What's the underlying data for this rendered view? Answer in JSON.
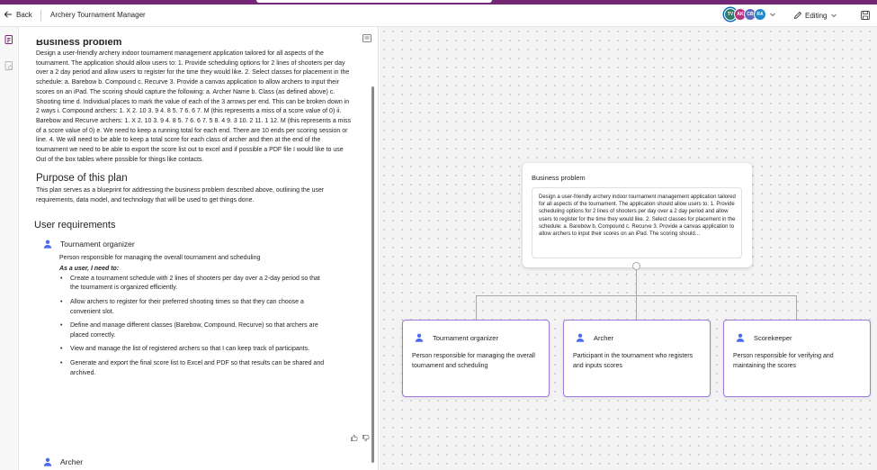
{
  "header": {
    "back_label": "Back",
    "app_title": "Archery Tournament Manager",
    "editing_label": "Editing",
    "avatars": [
      {
        "initials": "TV",
        "color": "#2e7d6b"
      },
      {
        "initials": "AK",
        "color": "#b4367f"
      },
      {
        "initials": "CB",
        "color": "#5c6bc0"
      },
      {
        "initials": "RA",
        "color": "#1e88c9"
      }
    ]
  },
  "document": {
    "business_heading": "Business problem",
    "business_text": "Design a user-friendly archery indoor tournament management application tailored for all aspects of the tournament. The application should allow users to: 1. Provide scheduling options for 2 lines of shooters per day over a 2 day period and allow users to register for the time they would like. 2. Select classes for placement in the schedule: a. Barebow b. Compound c. Recurve 3. Provide a canvas application to allow archers to input their scores on an iPad. The scoring should capture the following: a. Archer Name b. Class (as defined above) c. Shooting time d. Individual places to mark the value of each of the 3 arrows per end. This can be broken down in 2 ways i. Compound archers: 1. X 2. 10 3. 9 4. 8 5. 7 6. 6 7. M (this represents a miss of a score value of 0) ii. Barebow and Recurve archers: 1. X 2. 10 3. 9 4. 8 5. 7 6. 6 7. 5 8. 4 9. 3 10. 2 11. 1 12. M (this represents a miss of a score value of 0) e. We need to keep a running total for each end. There are 10 ends per scoring session or line. 4. We will need to be able to keep a total score for each class of archer and then at the end of the tournament we need to be able to export the score list out to excel and if possible a PDF file I would like to use Out of the box tables where possible for things like contacts.",
    "purpose_heading": "Purpose of this plan",
    "purpose_text": "This plan serves as a blueprint for addressing the business problem described above, outlining the user requirements, data model, and technology that will be used to get things done.",
    "requirements_heading": "User requirements",
    "personas": [
      {
        "name": "Tournament organizer",
        "description": "Person responsible for managing the overall tournament and scheduling",
        "need_label": "As a user, I need to:",
        "needs": [
          "Create a tournament schedule with 2 lines of shooters per day over a 2-day period so that the tournament is organized efficiently.",
          "Allow archers to register for their preferred shooting times so that they can choose a convenient slot.",
          "Define and manage different classes (Barebow, Compound, Recurve) so that archers are placed correctly.",
          "View and manage the list of registered archers so that I can keep track of participants.",
          "Generate and export the final score list to Excel and PDF so that results can be shared and archived."
        ]
      },
      {
        "name": "Archer"
      }
    ]
  },
  "canvas": {
    "business_card": {
      "title": "Business problem",
      "text": "Design a user-friendly archery indoor tournament management application tailored for all aspects of the tournament. The application should allow users to: 1. Provide scheduling options for 2 lines of shooters per day over a 2 day period and allow users to register for the time they would like. 2. Select classes for placement in the schedule: a. Barebow b. Compound c. Recurve 3. Provide a canvas application to allow archers to input their scores on an iPad. The scoring should…"
    },
    "persona_cards": [
      {
        "title": "Tournament organizer",
        "description": "Person responsible for managing the overall tournament and scheduling"
      },
      {
        "title": "Archer",
        "description": "Participant in the tournament who registers and inputs scores"
      },
      {
        "title": "Scorekeeper",
        "description": "Person responsible for verifying and maintaining the scores"
      }
    ]
  },
  "colors": {
    "accent": "#742774",
    "persona_icon": "#4f6bed",
    "card_border": "#9d7bd8"
  },
  "icons": {
    "back": "arrow-left-icon",
    "edit": "pencil-icon",
    "save": "save-icon",
    "persona": "person-icon",
    "like": "thumbs-up-icon",
    "dislike": "thumbs-down-icon"
  }
}
